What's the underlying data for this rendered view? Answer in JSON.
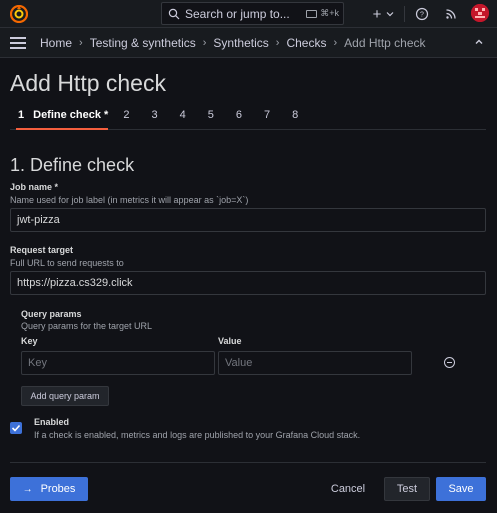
{
  "topbar": {
    "search_placeholder": "Search or jump to...",
    "search_shortcut": "⌘+k",
    "plus_label": "+",
    "icons": [
      "grafana-logo-icon",
      "search-icon",
      "plus-icon",
      "chevron-down-icon",
      "help-icon",
      "rss-icon",
      "avatar"
    ]
  },
  "breadcrumbs": [
    {
      "label": "Home"
    },
    {
      "label": "Testing & synthetics"
    },
    {
      "label": "Synthetics"
    },
    {
      "label": "Checks"
    },
    {
      "label": "Add Http check"
    }
  ],
  "page": {
    "title": "Add Http check",
    "steps": [
      "1",
      "Define check *",
      "2",
      "3",
      "4",
      "5",
      "6",
      "7",
      "8"
    ],
    "section_title": "1. Define check"
  },
  "form": {
    "job_name": {
      "label": "Job name *",
      "description": "Name used for job label (in metrics it will appear as `job=X`)",
      "value": "jwt-pizza"
    },
    "request_target": {
      "label": "Request target",
      "description": "Full URL to send requests to",
      "value": "https://pizza.cs329.click"
    },
    "query_params": {
      "label": "Query params",
      "description": "Query params for the target URL",
      "key_header": "Key",
      "value_header": "Value",
      "key_placeholder": "Key",
      "value_placeholder": "Value",
      "add_button": "Add query param"
    },
    "enabled": {
      "label": "Enabled",
      "description": "If a check is enabled, metrics and logs are published to your Grafana Cloud stack.",
      "checked": true
    }
  },
  "footer": {
    "probes_button": "Probes",
    "probes_arrow": "→",
    "cancel_button": "Cancel",
    "test_button": "Test",
    "save_button": "Save"
  },
  "colors": {
    "background": "#111217",
    "primary": "#3d71d9",
    "accent": "#f55f3e"
  }
}
